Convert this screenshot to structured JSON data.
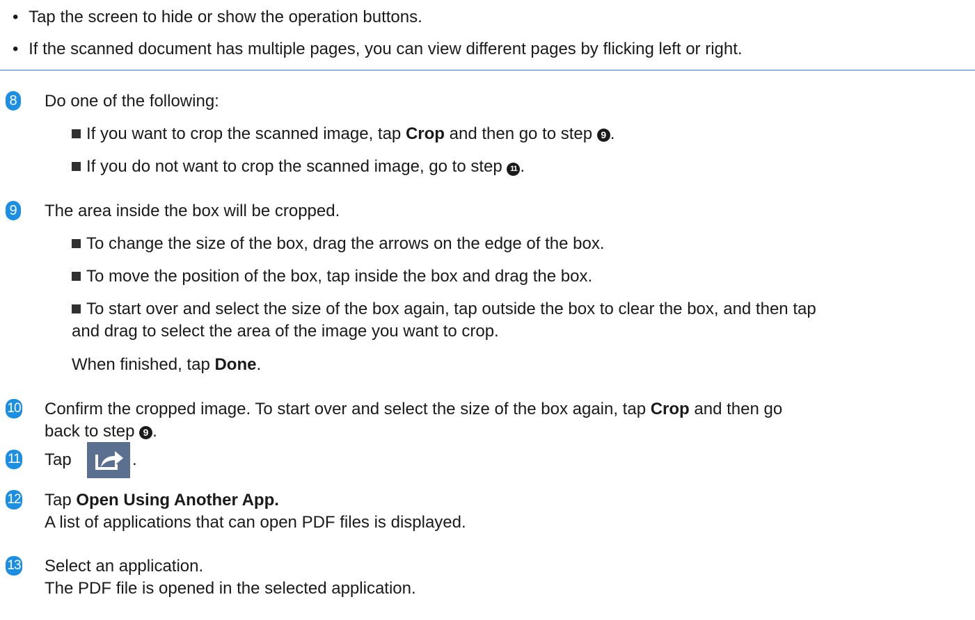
{
  "notes": {
    "b1": "Tap the screen to hide or show the operation buttons.",
    "b2": "If the scanned document has multiple pages, you can view different pages by flicking left or right.",
    "bullet": "•"
  },
  "steps": {
    "s8": {
      "num": "8",
      "text": "Do one of the following:",
      "o1_pre": "If you want to crop the scanned image, tap ",
      "o1_bold": "Crop",
      "o1_mid": " and then go to step ",
      "o1_ref": "9",
      "o1_end": ".",
      "o2_pre": "If you do not want to crop the scanned image, go to step ",
      "o2_ref": "11",
      "o2_end": "."
    },
    "s9": {
      "num": "9",
      "text": "The area inside the box will be cropped.",
      "o1": "To change the size of the box, drag the arrows on the edge of the box.",
      "o2": "To move the position of the box, tap inside the box and drag the box.",
      "o3a": "To start over and select the size of the box again, tap outside the box to clear the box, and then tap",
      "o3b": "and drag to select the area of the image you want to crop.",
      "fin_pre": "When finished, tap ",
      "fin_bold": "Done",
      "fin_end": "."
    },
    "s10": {
      "num": "10",
      "l1_pre": "Confirm the cropped image. To start over and select the size of the box again, tap ",
      "l1_bold": "Crop",
      "l1_end": " and then go",
      "l2_pre": "back to step ",
      "l2_ref": "9",
      "l2_end": "."
    },
    "s11": {
      "num": "11",
      "pre": "Tap",
      "end": ".",
      "icon": "share-icon"
    },
    "s12": {
      "num": "12",
      "pre": "Tap ",
      "bold": "Open Using Another App.",
      "l2": "A list of applications that can open PDF files is displayed."
    },
    "s13": {
      "num": "13",
      "l1": "Select an application.",
      "l2": "The PDF file is opened in the selected application."
    }
  },
  "colors": {
    "step_badge": "#1c8fe3",
    "divider": "#93b4e3",
    "icon_bg": "#5b6f90"
  }
}
